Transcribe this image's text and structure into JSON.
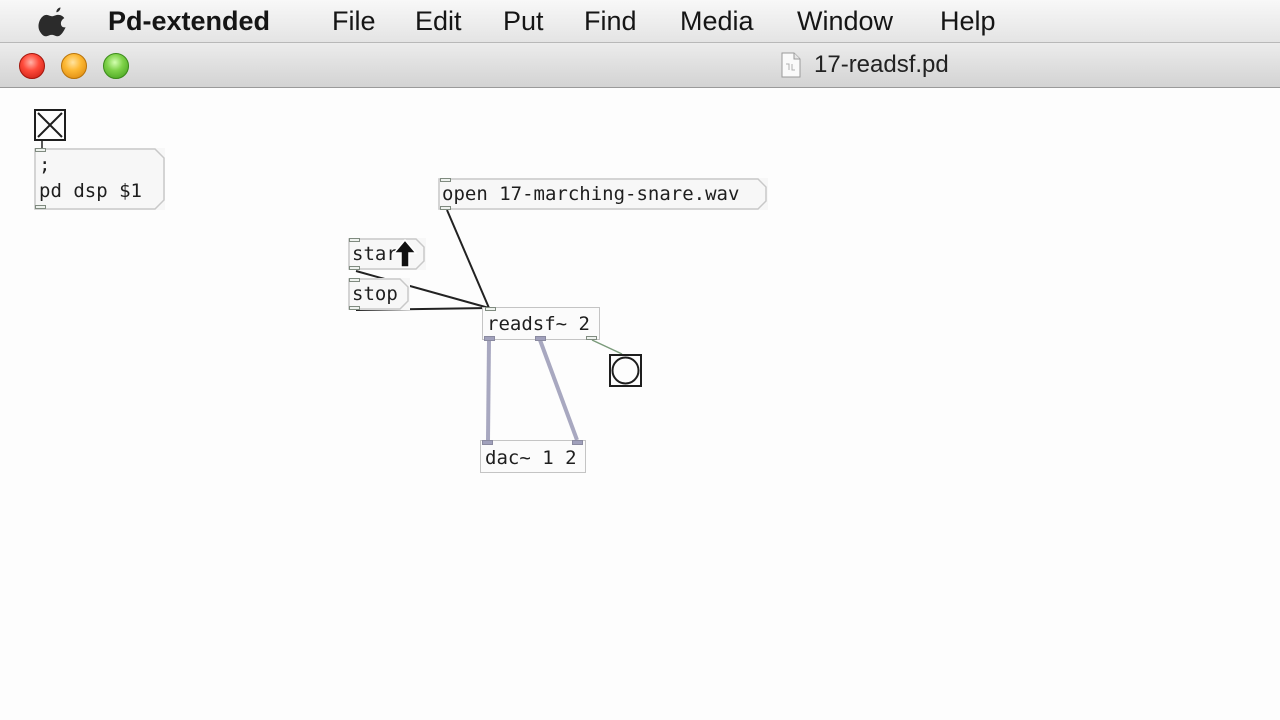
{
  "menubar": {
    "app_name": "Pd-extended",
    "items": [
      "File",
      "Edit",
      "Put",
      "Find",
      "Media",
      "Window",
      "Help"
    ]
  },
  "window": {
    "title": "17-readsf.pd"
  },
  "patch": {
    "toggle_checked": true,
    "dsp_message": [
      ";",
      "pd dsp $1"
    ],
    "open_message": "open 17-marching-snare.wav",
    "start_message": "start",
    "stop_message": "stop",
    "readsf_object": "readsf~ 2",
    "dac_object": "dac~ 1 2"
  },
  "colors": {
    "close_button": "#ff4b3b",
    "minimize_button": "#fdb833",
    "zoom_button": "#7fd24a",
    "signal_wire": "#a8a8c0",
    "control_wire": "#222222"
  }
}
